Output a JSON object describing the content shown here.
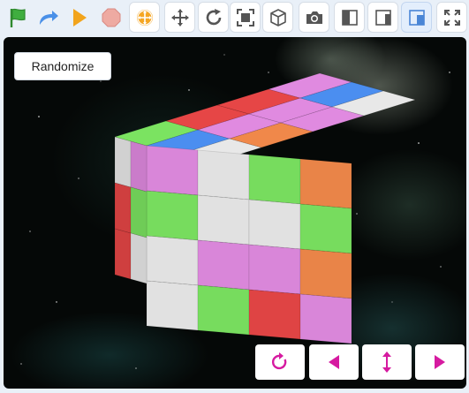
{
  "toolbar": {
    "icons": [
      "green-flag-icon",
      "turbo-arrow-icon",
      "play-icon",
      "stop-icon",
      "orbit-icon",
      "pan-icon",
      "rotate-icon",
      "fit-view-icon",
      "cube-view-icon",
      "camera-icon",
      "layout-left-icon",
      "layout-right-icon",
      "layout-corner-icon",
      "fullscreen-icon"
    ]
  },
  "stage": {
    "randomize_label": "Randomize"
  },
  "controls": {
    "icons": [
      "undo-icon",
      "left-arrow-icon",
      "vertical-arrow-icon",
      "right-arrow-icon"
    ],
    "accent": "#d61aa0"
  },
  "cube": {
    "colors": {
      "red": "#e64646",
      "green": "#7be361",
      "pink": "#e08ae0",
      "white": "#e8e8e8",
      "blue": "#4b8ef0",
      "orange": "#f0884a"
    },
    "top": [
      [
        "green",
        "red",
        "red",
        "pink"
      ],
      [
        "blue",
        "pink",
        "pink",
        "blue"
      ],
      [
        "white",
        "orange",
        "pink",
        "white"
      ]
    ],
    "front": [
      [
        "pink",
        "white",
        "green",
        "orange"
      ],
      [
        "green",
        "white",
        "white",
        "green"
      ],
      [
        "white",
        "pink",
        "pink",
        "orange"
      ],
      [
        "white",
        "green",
        "red",
        "pink"
      ]
    ],
    "left": [
      [
        "white",
        "pink"
      ],
      [
        "red",
        "green"
      ],
      [
        "red",
        "white"
      ]
    ]
  }
}
